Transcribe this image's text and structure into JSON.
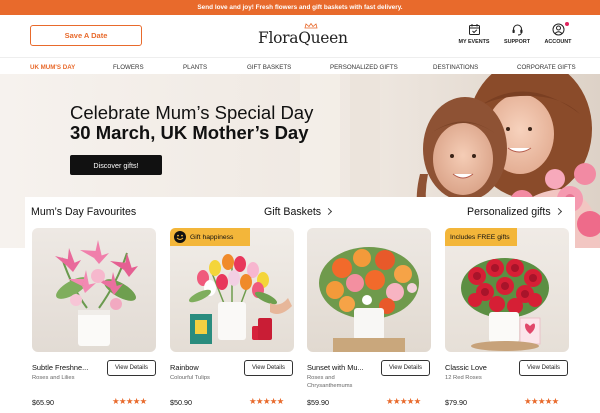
{
  "topbar": {
    "text": "Send love and joy! Fresh flowers and gift baskets with fast delivery."
  },
  "header": {
    "save_date_label": "Save A Date",
    "logo_text": "FloraQueen",
    "icons": [
      {
        "name": "my-events",
        "label": "MY EVENTS",
        "icon": "calendar-icon"
      },
      {
        "name": "support",
        "label": "SUPPORT",
        "icon": "headset-icon"
      },
      {
        "name": "account",
        "label": "ACCOUNT",
        "icon": "user-icon"
      }
    ]
  },
  "nav": {
    "items": [
      "UK MUM'S DAY",
      "FLOWERS",
      "PLANTS",
      "GIFT BASKETS",
      "PERSONALIZED GIFTS",
      "DESTINATIONS",
      "CORPORATE GIFTS"
    ],
    "active": "UK MUM'S DAY"
  },
  "hero": {
    "line1": "Celebrate Mum’s Special Day",
    "line2": "30 March, UK Mother’s Day",
    "button": "Discover gifts!"
  },
  "sections": {
    "favourites": "Mum’s Day Favourites",
    "gift_baskets": "Gift Baskets",
    "personalized": "Personalized gifts"
  },
  "products": [
    {
      "name": "Subtle Freshne...",
      "subtitle": "Roses and Lilies",
      "price": "$65.90",
      "badge": "",
      "rating": 5
    },
    {
      "name": "Rainbow",
      "subtitle": "Colourful Tulips",
      "price": "$50.90",
      "badge": "Gift happiness",
      "rating": 5
    },
    {
      "name": "Sunset with Mu...",
      "subtitle": "Roses and Chrysanthemums",
      "price": "$59.90",
      "badge": "",
      "rating": 5
    },
    {
      "name": "Classic Love",
      "subtitle": "12 Red Roses",
      "price": "$79.90",
      "badge": "Includes FREE gifts",
      "rating": 5
    }
  ],
  "view_details_label": "View Details",
  "colors": {
    "accent": "#e86a2c",
    "badge_yellow": "#f3b63a",
    "dark": "#111111"
  }
}
